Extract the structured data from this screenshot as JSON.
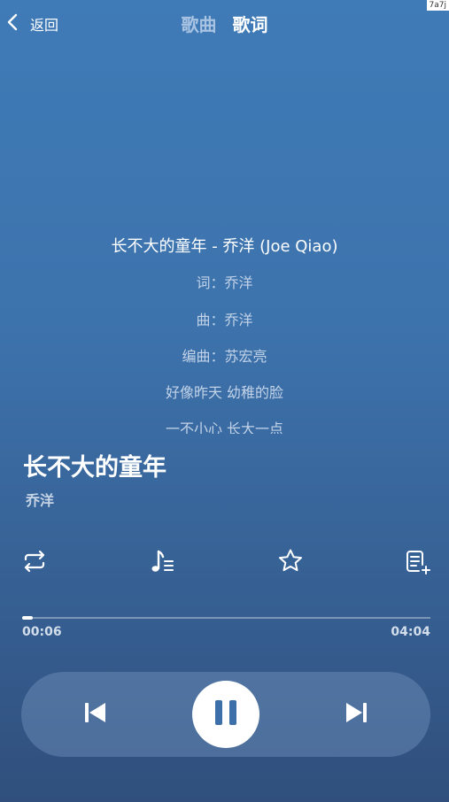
{
  "corner_tag": "7a7j",
  "header": {
    "back_label": "返回",
    "tabs": [
      {
        "label": "歌曲",
        "active": false
      },
      {
        "label": "歌词",
        "active": true
      }
    ]
  },
  "lyrics": {
    "lines": [
      "长不大的童年 - 乔洋 (Joe Qiao)",
      "词：乔洋",
      "曲：乔洋",
      "编曲：苏宏亮",
      "好像昨天 幼稚的脸",
      "一不小心 长大一点"
    ]
  },
  "song": {
    "title": "长不大的童年",
    "artist": "乔洋"
  },
  "actions": {
    "icons": [
      "repeat-icon",
      "lyrics-icon",
      "star-icon",
      "playlist-add-icon"
    ]
  },
  "progress": {
    "current": "00:06",
    "total": "04:04",
    "fraction": 0.025
  },
  "controls": {
    "icons": [
      "previous-icon",
      "pause-icon",
      "next-icon"
    ]
  },
  "colors": {
    "background_top": "#3f7bb7",
    "background_bottom": "#304f7c",
    "inactive_tab": "#a9c3e2",
    "lyric_text": "#c2d3e8",
    "play_button": "#ffffff",
    "play_icon": "#3d6fa8"
  }
}
